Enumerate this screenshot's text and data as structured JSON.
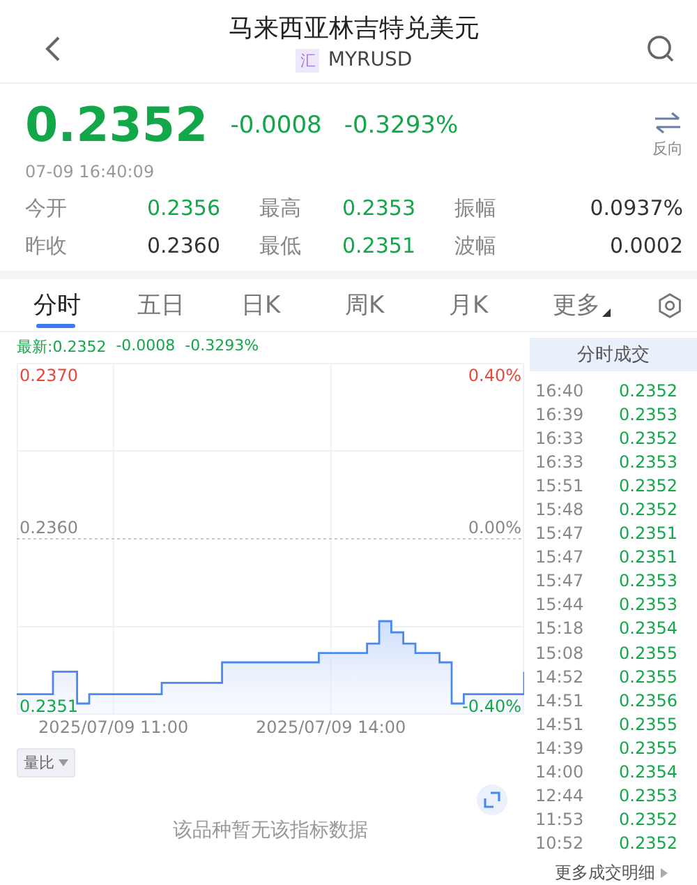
{
  "header": {
    "title": "马来西亚林吉特兑美元",
    "badge": "汇",
    "symbol": "MYRUSD"
  },
  "quote": {
    "price": "0.2352",
    "change": "-0.0008",
    "change_pct": "-0.3293%",
    "time": "07-09 16:40:09",
    "reverse_label": "反向"
  },
  "stats": [
    {
      "label": "今开",
      "value": "0.2356",
      "color": "#12a84a"
    },
    {
      "label": "最高",
      "value": "0.2353",
      "color": "#12a84a"
    },
    {
      "label": "振幅",
      "value": "0.0937%",
      "color": "#333333"
    },
    {
      "label": "昨收",
      "value": "0.2360",
      "color": "#333333"
    },
    {
      "label": "最低",
      "value": "0.2351",
      "color": "#12a84a"
    },
    {
      "label": "波幅",
      "value": "0.0002",
      "color": "#333333"
    }
  ],
  "tabs": [
    {
      "label": "分时",
      "selected": true,
      "kind": "tab"
    },
    {
      "label": "五日",
      "selected": false,
      "kind": "tab"
    },
    {
      "label": "日K",
      "selected": false,
      "kind": "tab"
    },
    {
      "label": "周K",
      "selected": false,
      "kind": "tab"
    },
    {
      "label": "月K",
      "selected": false,
      "kind": "tab"
    },
    {
      "label": "更多",
      "selected": false,
      "kind": "menu"
    }
  ],
  "latest": {
    "text": "最新:0.2352",
    "change": "-0.0008",
    "change_pct": "-0.3293%"
  },
  "chart": {
    "percent_labels": [
      "0.40%",
      "0.00%",
      "-0.40%"
    ],
    "price_labels": [
      "0.2370",
      "0.2360",
      "0.2351"
    ],
    "time_labels": [
      "2025/07/09 11:00",
      "2025/07/09 14:00"
    ]
  },
  "indicator": {
    "selector": "量比",
    "message": "该品种暂无该指标数据"
  },
  "trades": {
    "title": "分时成交",
    "more": "更多成交明细",
    "rows": [
      {
        "time": "16:40",
        "price": "0.2352"
      },
      {
        "time": "16:39",
        "price": "0.2353"
      },
      {
        "time": "16:33",
        "price": "0.2352"
      },
      {
        "time": "16:33",
        "price": "0.2353"
      },
      {
        "time": "15:51",
        "price": "0.2352"
      },
      {
        "time": "15:48",
        "price": "0.2352"
      },
      {
        "time": "15:47",
        "price": "0.2351"
      },
      {
        "time": "15:47",
        "price": "0.2351"
      },
      {
        "time": "15:47",
        "price": "0.2353"
      },
      {
        "time": "15:44",
        "price": "0.2353"
      },
      {
        "time": "15:18",
        "price": "0.2354"
      },
      {
        "time": "15:08",
        "price": "0.2355"
      },
      {
        "time": "14:52",
        "price": "0.2355"
      },
      {
        "time": "14:51",
        "price": "0.2356"
      },
      {
        "time": "14:51",
        "price": "0.2355"
      },
      {
        "time": "14:39",
        "price": "0.2355"
      },
      {
        "time": "14:00",
        "price": "0.2354"
      },
      {
        "time": "12:44",
        "price": "0.2353"
      },
      {
        "time": "11:53",
        "price": "0.2352"
      },
      {
        "time": "10:52",
        "price": "0.2352"
      }
    ]
  }
}
